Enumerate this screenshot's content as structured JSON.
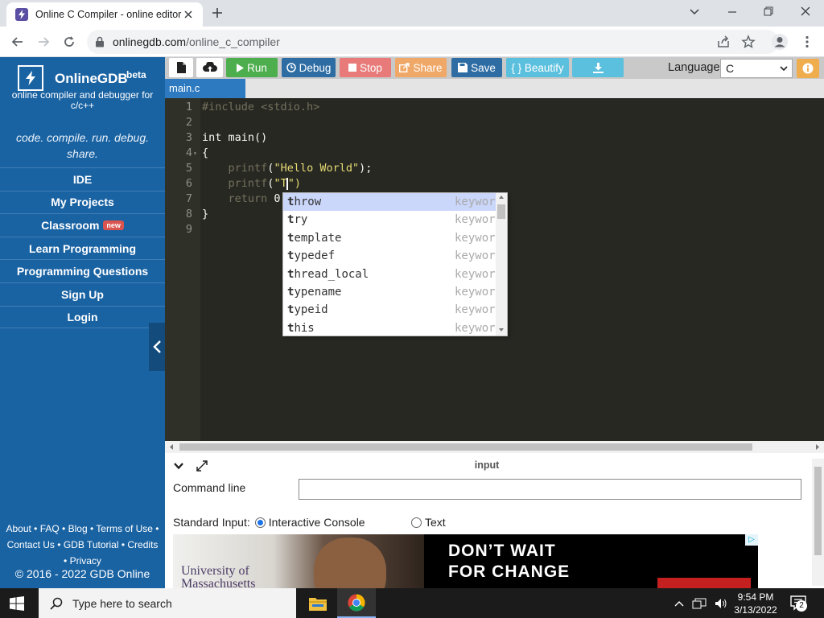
{
  "browser": {
    "tab_title": "Online C Compiler - online editor",
    "url_host": "onlinegdb.com",
    "url_path": "/online_c_compiler"
  },
  "sidebar": {
    "brand_name": "OnlineGDB",
    "brand_beta": "beta",
    "brand_sub": "online compiler and debugger for c/c++",
    "tagline": "code. compile. run. debug. share.",
    "nav": [
      {
        "label": "IDE"
      },
      {
        "label": "My Projects"
      },
      {
        "label": "Classroom",
        "badge": "new"
      },
      {
        "label": "Learn Programming"
      },
      {
        "label": "Programming Questions"
      },
      {
        "label": "Sign Up"
      },
      {
        "label": "Login"
      }
    ],
    "footer": {
      "about": "About",
      "faq": "FAQ",
      "blog": "Blog",
      "terms": "Terms of Use",
      "contact": "Contact Us",
      "gdb_tutorial": "GDB Tutorial",
      "credits": "Credits",
      "privacy": "Privacy",
      "separator": " • "
    },
    "copyright": "© 2016 - 2022 GDB Online"
  },
  "toolbar": {
    "run": "Run",
    "debug": "Debug",
    "stop": "Stop",
    "share": "Share",
    "save": "Save",
    "beautify": "{ } Beautify",
    "language_label": "Language",
    "language_value": "C",
    "colors": {
      "run": "#4cae4c",
      "debug": "#2e6da4",
      "stop": "#e87a7a",
      "share": "#f0a868",
      "save": "#2e6da4",
      "beautify": "#5bc0de",
      "download": "#5bc0de"
    }
  },
  "file_tab": "main.c",
  "editor": {
    "line_numbers": [
      "1",
      "2",
      "3",
      "4",
      "5",
      "6",
      "7",
      "8",
      "9"
    ],
    "fold_marker": "▾",
    "lines": {
      "l1_pp": "#include <stdio.h>",
      "l3": "int main()",
      "l4": "{",
      "l5_indent": "    ",
      "l5_fn": "printf",
      "l5_open": "(",
      "l5_str": "\"Hello World\"",
      "l5_close": ");",
      "l6_fn": "printf",
      "l6_open": "(",
      "l6_str": "\"T",
      "l6_close": "\")",
      "l7_kw": "return",
      "l7_rest": " 0;",
      "l8": "}"
    },
    "autocomplete": [
      {
        "prefix": "t",
        "rest": "hrow",
        "meta": "keywor",
        "selected": true
      },
      {
        "prefix": "t",
        "rest": "ry",
        "meta": "keywor"
      },
      {
        "prefix": "t",
        "rest": "emplate",
        "meta": "keywor"
      },
      {
        "prefix": "t",
        "rest": "ypedef",
        "meta": "keywor"
      },
      {
        "prefix": "t",
        "rest": "hread_local",
        "meta": "keywor"
      },
      {
        "prefix": "t",
        "rest": "ypename",
        "meta": "keywor"
      },
      {
        "prefix": "t",
        "rest": "ypeid",
        "meta": "keywor"
      },
      {
        "prefix": "t",
        "rest": "his",
        "meta": "keywor"
      }
    ]
  },
  "panel": {
    "title": "input",
    "command_line_label": "Command line",
    "command_line_value": "",
    "stdin_label": "Standard Input:",
    "option_interactive": "Interactive Console",
    "option_text": "Text",
    "selected_option": "Interactive Console"
  },
  "ad": {
    "university_line1": "University of",
    "university_line2": "Massachusetts",
    "headline_line1": "DON’T WAIT",
    "headline_line2": "FOR CHANGE"
  },
  "taskbar": {
    "search_placeholder": "Type here to search",
    "time": "9:54 PM",
    "date": "3/13/2022",
    "notification_count": "2"
  }
}
